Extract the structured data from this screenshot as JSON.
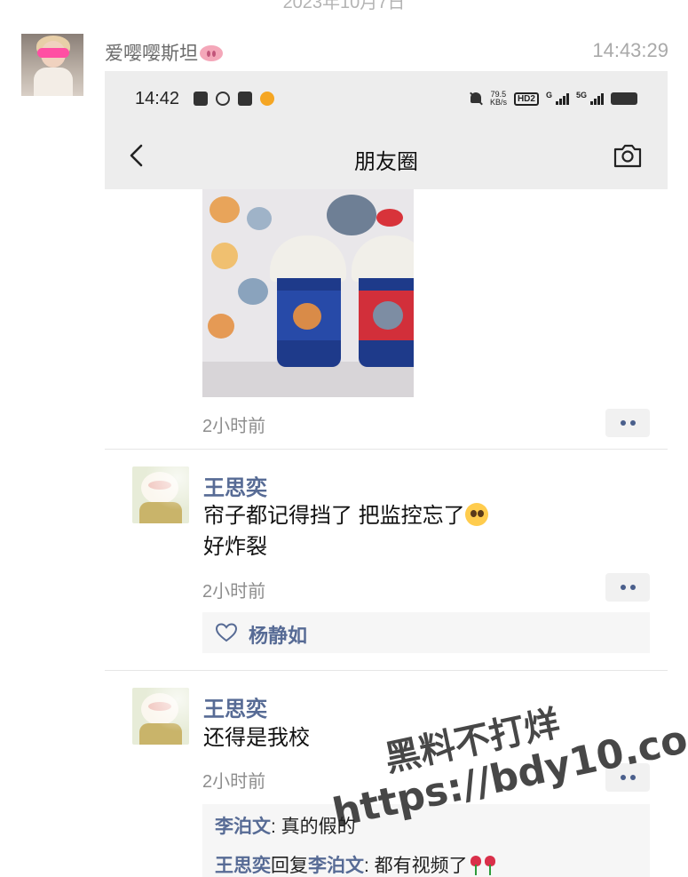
{
  "chat": {
    "date_partial": "2023年10月7日",
    "sender_name": "爱嘤嘤斯坦",
    "sender_emoji": "pig-nose-emoji",
    "sent_time": "14:43:29"
  },
  "screenshot": {
    "statusbar": {
      "time": "14:42",
      "net_speed_value": "79.5",
      "net_speed_unit": "KB/s",
      "hd_label": "HD2",
      "gen1": "G",
      "gen2": "5G"
    },
    "navbar": {
      "title": "朋友圈",
      "back_icon": "chevron-left-icon",
      "camera_icon": "camera-icon"
    },
    "post": {
      "time": "2小时前"
    },
    "comments": [
      {
        "author": "王思奕",
        "text_line1": "帘子都记得挡了 把监控忘了",
        "text_line2": "好炸裂",
        "emoji": "pleading-face-emoji",
        "time": "2小时前",
        "likes": [
          "杨静如"
        ]
      },
      {
        "author": "王思奕",
        "text_line1": "还得是我校",
        "time": "2小时前",
        "replies": [
          {
            "author": "李泊文",
            "sep": ": ",
            "text": "真的假的"
          },
          {
            "author": "王思奕",
            "verb": "回复",
            "target": "李泊文",
            "sep": ": ",
            "text": "都有视频了"
          }
        ]
      }
    ]
  },
  "watermark": {
    "line1": "黑料不打烊",
    "line2": "https://bdy10.co"
  },
  "colors": {
    "link": "#576b95",
    "bar": "#ededed",
    "muted": "#8e8e8e"
  }
}
